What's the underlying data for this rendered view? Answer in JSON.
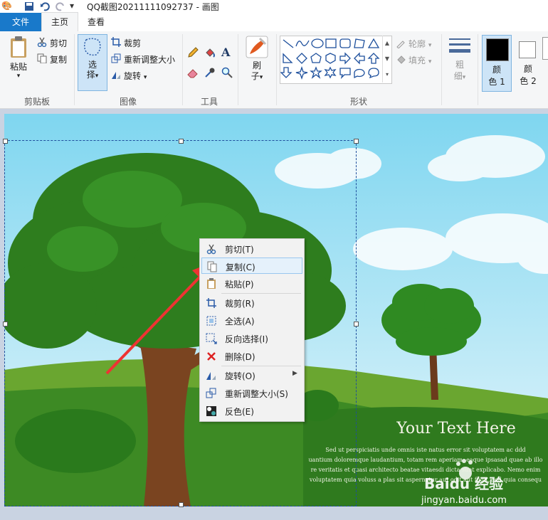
{
  "window": {
    "title": "QQ截图20211111092737 - 画图"
  },
  "tabs": {
    "file": "文件",
    "home": "主页",
    "view": "查看"
  },
  "ribbon": {
    "clipboard": {
      "paste": "粘贴",
      "cut": "剪切",
      "copy": "复制",
      "label": "剪贴板"
    },
    "image": {
      "select_line1": "选",
      "select_line2": "择",
      "crop": "裁剪",
      "resize": "重新调整大小",
      "rotate": "旋转",
      "label": "图像"
    },
    "tools": {
      "label": "工具"
    },
    "brushes": {
      "line1": "刷",
      "line2": "子"
    },
    "shapes": {
      "outline": "轮廓",
      "fill": "填充",
      "label": "形状"
    },
    "size": {
      "line1": "粗",
      "line2": "细"
    },
    "color1": {
      "line1": "颜",
      "line2": "色 1",
      "value": "#000000"
    },
    "color2": {
      "line1": "颜",
      "line2": "色 2",
      "value": "#ffffff"
    }
  },
  "context_menu": [
    {
      "label": "剪切(T)",
      "icon": "scissors-icon"
    },
    {
      "label": "复制(C)",
      "icon": "copy-icon",
      "highlighted": true
    },
    {
      "label": "粘贴(P)",
      "icon": "paste-icon"
    },
    {
      "label": "裁剪(R)",
      "icon": "crop-icon"
    },
    {
      "label": "全选(A)",
      "icon": "select-all-icon"
    },
    {
      "label": "反向选择(I)",
      "icon": "invert-selection-icon"
    },
    {
      "label": "删除(D)",
      "icon": "delete-icon"
    },
    {
      "label": "旋转(O)",
      "icon": "rotate-icon"
    },
    {
      "label": "重新调整大小(S)",
      "icon": "resize-icon"
    },
    {
      "label": "反色(E)",
      "icon": "invert-color-icon"
    }
  ],
  "image_content": {
    "heading": "Your Text Here",
    "lines": [
      "Sed ut perspiciatis unde omnis iste natus error sit voluptatem ac ddd",
      "uantium doloremque laudantium, totam rem aperiam, eaque ipsasad quae ab illo",
      "re veritatis et quasi architecto beatae vitaesdi dicta sunt explicabo. Nemo enim",
      "voluptatem quia voluss a plas sit aspernatur aut odit aut fugit, sed quia consequ"
    ]
  },
  "watermark": {
    "brand": "Baidu 经验",
    "url": "jingyan.baidu.com"
  }
}
